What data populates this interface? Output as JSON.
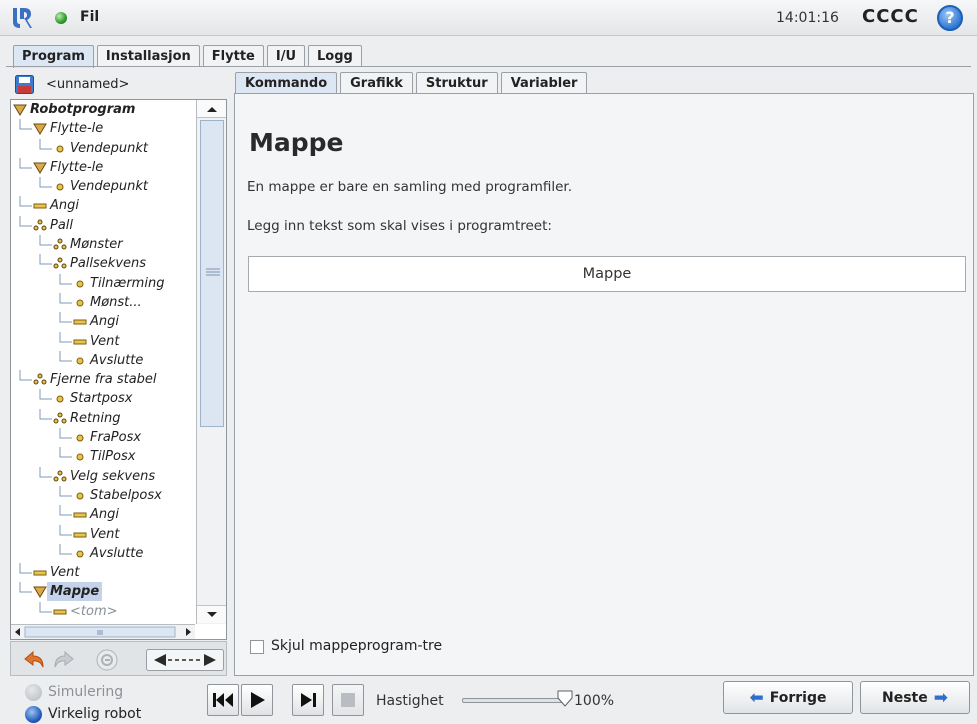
{
  "topbar": {
    "file_menu": "Fil",
    "clock": "14:01:16",
    "robot_name": "CCCC",
    "help_glyph": "?",
    "status_color": "#2d9a2a"
  },
  "main_tabs": [
    {
      "label": "Program",
      "active": true
    },
    {
      "label": "Installasjon",
      "active": false
    },
    {
      "label": "Flytte",
      "active": false
    },
    {
      "label": "I/U",
      "active": false
    },
    {
      "label": "Logg",
      "active": false
    }
  ],
  "program": {
    "name": "<unnamed>",
    "tree": [
      {
        "label": "Robotprogram",
        "icon": "triangle-icon",
        "depth": 0,
        "bold": true
      },
      {
        "label": "Flytte-le",
        "icon": "triangle-icon",
        "depth": 1
      },
      {
        "label": "Vendepunkt",
        "icon": "waypoint-icon",
        "depth": 2
      },
      {
        "label": "Flytte-le",
        "icon": "triangle-icon",
        "depth": 1
      },
      {
        "label": "Vendepunkt",
        "icon": "waypoint-icon",
        "depth": 2
      },
      {
        "label": "Angi",
        "icon": "set-icon",
        "depth": 1
      },
      {
        "label": "Pall",
        "icon": "pallet-icon",
        "depth": 1
      },
      {
        "label": "Mønster",
        "icon": "pallet-icon",
        "depth": 2
      },
      {
        "label": "Pallsekvens",
        "icon": "pallet-icon",
        "depth": 2
      },
      {
        "label": "Tilnærming",
        "icon": "waypoint-icon",
        "depth": 3
      },
      {
        "label": "Mønst...",
        "icon": "waypoint-icon",
        "depth": 3
      },
      {
        "label": "Angi",
        "icon": "set-icon",
        "depth": 3
      },
      {
        "label": "Vent",
        "icon": "set-icon",
        "depth": 3
      },
      {
        "label": "Avslutte",
        "icon": "waypoint-icon",
        "depth": 3
      },
      {
        "label": "Fjerne fra stabel",
        "icon": "pallet-icon",
        "depth": 1
      },
      {
        "label": "Startposx",
        "icon": "waypoint-icon",
        "depth": 2
      },
      {
        "label": "Retning",
        "icon": "pallet-icon",
        "depth": 2
      },
      {
        "label": "FraPosx",
        "icon": "waypoint-icon",
        "depth": 3
      },
      {
        "label": "TilPosx",
        "icon": "waypoint-icon",
        "depth": 3
      },
      {
        "label": "Velg sekvens",
        "icon": "pallet-icon",
        "depth": 2
      },
      {
        "label": "Stabelposx",
        "icon": "waypoint-icon",
        "depth": 3
      },
      {
        "label": "Angi",
        "icon": "set-icon",
        "depth": 3
      },
      {
        "label": "Vent",
        "icon": "set-icon",
        "depth": 3
      },
      {
        "label": "Avslutte",
        "icon": "waypoint-icon",
        "depth": 3
      },
      {
        "label": "Vent",
        "icon": "set-icon",
        "depth": 1
      },
      {
        "label": "Mappe",
        "icon": "triangle-icon",
        "depth": 1,
        "bold": true,
        "selected": true
      },
      {
        "label": "<tom>",
        "icon": "set-icon",
        "depth": 2,
        "dim": true
      }
    ]
  },
  "sub_tabs": [
    {
      "label": "Kommando",
      "active": true
    },
    {
      "label": "Grafikk",
      "active": false
    },
    {
      "label": "Struktur",
      "active": false
    },
    {
      "label": "Variabler",
      "active": false
    }
  ],
  "content": {
    "title": "Mappe",
    "description": "En mappe er bare en samling med programfiler.",
    "prompt": "Legg inn tekst som skal vises i programtreet:",
    "folder_name_value": "Mappe",
    "hide_checkbox_label": "Skjul mappeprogram-tre",
    "hide_checked": false
  },
  "bottom": {
    "simulation_label": "Simulering",
    "real_robot_label": "Virkelig robot",
    "speed_label": "Hastighet",
    "speed_value": "100%",
    "speed_fraction": 1.0,
    "prev_label": "Forrige",
    "next_label": "Neste"
  }
}
